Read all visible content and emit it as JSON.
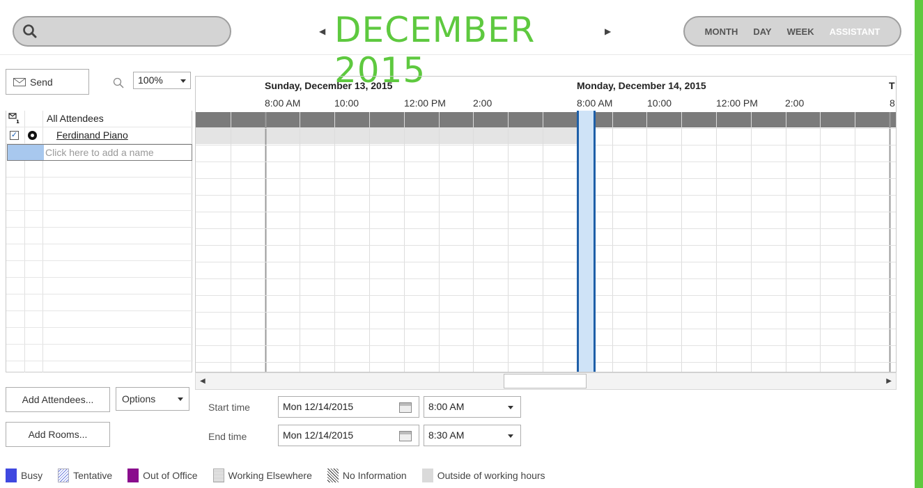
{
  "header": {
    "search_placeholder": "",
    "month_title": "DECEMBER 2015",
    "views": [
      "MONTH",
      "DAY",
      "WEEK",
      "ASSISTANT"
    ],
    "active_view": "ASSISTANT",
    "accent_color": "#5ec93f"
  },
  "toolbar": {
    "send_label": "Send",
    "zoom_value": "100%"
  },
  "attendees": {
    "header_label": "All Attendees",
    "rows": [
      {
        "name": "Ferdinand Piano",
        "checked": true
      }
    ],
    "add_placeholder": "Click here to add a name"
  },
  "schedule": {
    "days": [
      {
        "label": "Sunday, December 13, 2015",
        "times": [
          "8:00 AM",
          "10:00",
          "12:00 PM",
          "2:00"
        ]
      },
      {
        "label": "Monday, December 14, 2015",
        "times": [
          "8:00 AM",
          "10:00",
          "12:00 PM",
          "2:00"
        ]
      },
      {
        "label": "T",
        "times": [
          "8:"
        ]
      }
    ]
  },
  "controls": {
    "add_attendees": "Add Attendees...",
    "options": "Options",
    "add_rooms": "Add Rooms...",
    "start_label": "Start time",
    "end_label": "End time",
    "start_date": "Mon 12/14/2015",
    "start_time": "8:00 AM",
    "end_date": "Mon 12/14/2015",
    "end_time": "8:30 AM"
  },
  "legend": [
    {
      "label": "Busy",
      "color": "#3f48e0"
    },
    {
      "label": "Tentative"
    },
    {
      "label": "Out of Office",
      "color": "#8a0d8d"
    },
    {
      "label": "Working Elsewhere"
    },
    {
      "label": "No Information"
    },
    {
      "label": "Outside of working hours"
    }
  ]
}
